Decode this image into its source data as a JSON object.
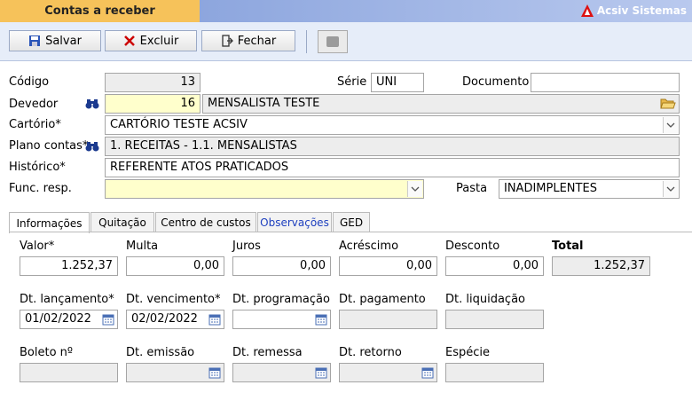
{
  "window": {
    "title": "Contas a receber",
    "brand": "Acsiv Sistemas"
  },
  "toolbar": {
    "save": "Salvar",
    "delete": "Excluir",
    "close": "Fechar"
  },
  "form": {
    "codigo_label": "Código",
    "codigo": "13",
    "serie_label": "Série",
    "serie": "UNI",
    "documento_label": "Documento",
    "documento": "",
    "devedor_label": "Devedor",
    "devedor_code": "16",
    "devedor_name": "MENSALISTA TESTE",
    "cartorio_label": "Cartório*",
    "cartorio": "CARTÓRIO TESTE ACSIV",
    "plano_label": "Plano contas*",
    "plano": "1. RECEITAS - 1.1. MENSALISTAS",
    "historico_label": "Histórico*",
    "historico": "REFERENTE ATOS PRATICADOS",
    "func_label": "Func. resp.",
    "func": "",
    "pasta_label": "Pasta",
    "pasta": "INADIMPLENTES"
  },
  "tabs": [
    "Informações",
    "Quitação",
    "Centro de custos",
    "Observações",
    "GED"
  ],
  "info": {
    "valor_label": "Valor*",
    "valor": "1.252,37",
    "multa_label": "Multa",
    "multa": "0,00",
    "juros_label": "Juros",
    "juros": "0,00",
    "acrescimo_label": "Acréscimo",
    "acrescimo": "0,00",
    "desconto_label": "Desconto",
    "desconto": "0,00",
    "total_label": "Total",
    "total": "1.252,37",
    "dt_lanc_label": "Dt. lançamento*",
    "dt_lanc": "01/02/2022",
    "dt_venc_label": "Dt. vencimento*",
    "dt_venc": "02/02/2022",
    "dt_prog_label": "Dt. programação",
    "dt_prog": "",
    "dt_pag_label": "Dt. pagamento",
    "dt_pag": "",
    "dt_liq_label": "Dt. liquidação",
    "dt_liq": "",
    "boleto_label": "Boleto nº",
    "boleto": "",
    "dt_emissao_label": "Dt. emissão",
    "dt_emissao": "",
    "dt_remessa_label": "Dt. remessa",
    "dt_remessa": "",
    "dt_retorno_label": "Dt. retorno",
    "dt_retorno": "",
    "especie_label": "Espécie",
    "especie": ""
  }
}
